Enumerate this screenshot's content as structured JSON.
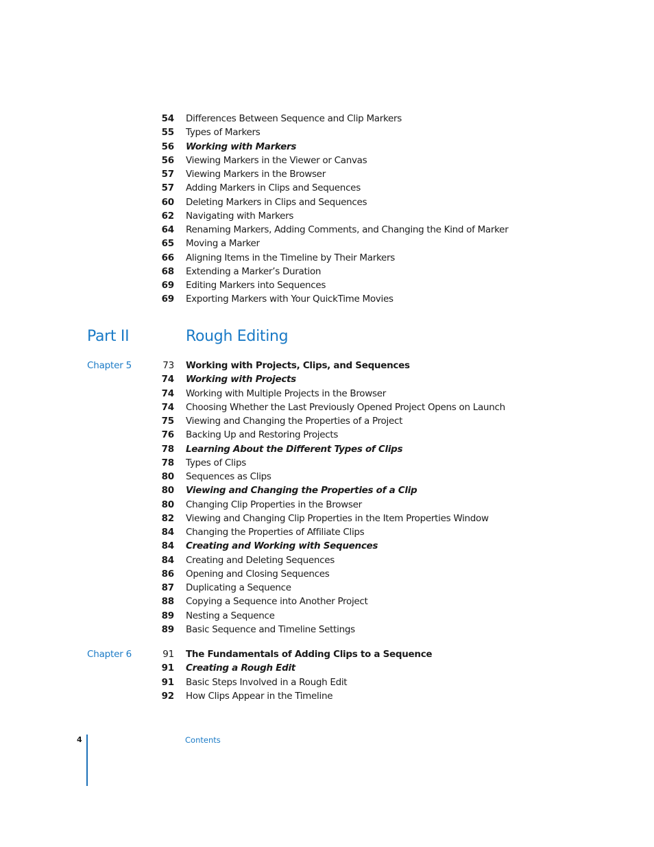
{
  "colors": {
    "accent": "#1a7ac6",
    "text": "#1a1a1a",
    "rule": "#1a6fb8"
  },
  "part_one_continued": [
    {
      "page": "54",
      "title": "Differences Between Sequence and Clip Markers",
      "style": "normal"
    },
    {
      "page": "55",
      "title": "Types of Markers",
      "style": "normal"
    },
    {
      "page": "56",
      "title": "Working with Markers",
      "style": "heading"
    },
    {
      "page": "56",
      "title": "Viewing Markers in the Viewer or Canvas",
      "style": "normal"
    },
    {
      "page": "57",
      "title": "Viewing Markers in the Browser",
      "style": "normal"
    },
    {
      "page": "57",
      "title": "Adding Markers in Clips and Sequences",
      "style": "normal"
    },
    {
      "page": "60",
      "title": "Deleting Markers in Clips and Sequences",
      "style": "normal"
    },
    {
      "page": "62",
      "title": "Navigating with Markers",
      "style": "normal"
    },
    {
      "page": "64",
      "title": "Renaming Markers, Adding Comments, and Changing the Kind of Marker",
      "style": "normal"
    },
    {
      "page": "65",
      "title": "Moving a Marker",
      "style": "normal"
    },
    {
      "page": "66",
      "title": "Aligning Items in the Timeline by Their Markers",
      "style": "normal"
    },
    {
      "page": "68",
      "title": "Extending a Marker’s Duration",
      "style": "normal"
    },
    {
      "page": "69",
      "title": "Editing Markers into Sequences",
      "style": "normal"
    },
    {
      "page": "69",
      "title": "Exporting Markers with Your QuickTime Movies",
      "style": "normal"
    }
  ],
  "part": {
    "label": "Part II",
    "title": "Rough Editing"
  },
  "chapters": [
    {
      "label": "Chapter 5",
      "entries": [
        {
          "page": "73",
          "title": "Working with Projects, Clips, and Sequences",
          "style": "chapter"
        },
        {
          "page": "74",
          "title": "Working with Projects",
          "style": "heading"
        },
        {
          "page": "74",
          "title": "Working with Multiple Projects in the Browser",
          "style": "normal"
        },
        {
          "page": "74",
          "title": "Choosing Whether the Last Previously Opened Project Opens on Launch",
          "style": "normal"
        },
        {
          "page": "75",
          "title": "Viewing and Changing the Properties of a Project",
          "style": "normal"
        },
        {
          "page": "76",
          "title": "Backing Up and Restoring Projects",
          "style": "normal"
        },
        {
          "page": "78",
          "title": "Learning About the Different Types of Clips",
          "style": "heading"
        },
        {
          "page": "78",
          "title": "Types of Clips",
          "style": "normal"
        },
        {
          "page": "80",
          "title": "Sequences as Clips",
          "style": "normal"
        },
        {
          "page": "80",
          "title": "Viewing and Changing the Properties of a Clip",
          "style": "heading"
        },
        {
          "page": "80",
          "title": "Changing Clip Properties in the Browser",
          "style": "normal"
        },
        {
          "page": "82",
          "title": "Viewing and Changing Clip Properties in the Item Properties Window",
          "style": "normal"
        },
        {
          "page": "84",
          "title": "Changing the Properties of Affiliate Clips",
          "style": "normal"
        },
        {
          "page": "84",
          "title": "Creating and Working with Sequences",
          "style": "heading"
        },
        {
          "page": "84",
          "title": "Creating and Deleting Sequences",
          "style": "normal"
        },
        {
          "page": "86",
          "title": "Opening and Closing Sequences",
          "style": "normal"
        },
        {
          "page": "87",
          "title": "Duplicating a Sequence",
          "style": "normal"
        },
        {
          "page": "88",
          "title": "Copying a Sequence into Another Project",
          "style": "normal"
        },
        {
          "page": "89",
          "title": "Nesting a Sequence",
          "style": "normal"
        },
        {
          "page": "89",
          "title": "Basic Sequence and Timeline Settings",
          "style": "normal"
        }
      ]
    },
    {
      "label": "Chapter 6",
      "entries": [
        {
          "page": "91",
          "title": "The Fundamentals of Adding Clips to a Sequence",
          "style": "chapter"
        },
        {
          "page": "91",
          "title": "Creating a Rough Edit",
          "style": "heading"
        },
        {
          "page": "91",
          "title": "Basic Steps Involved in a Rough Edit",
          "style": "normal"
        },
        {
          "page": "92",
          "title": "How Clips Appear in the Timeline",
          "style": "normal"
        }
      ]
    }
  ],
  "footer": {
    "page_number": "4",
    "section": "Contents"
  }
}
